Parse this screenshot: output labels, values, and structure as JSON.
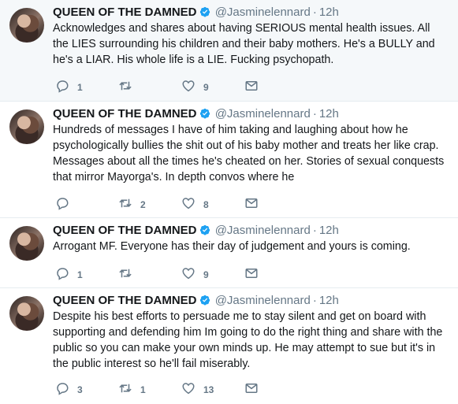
{
  "tweets": [
    {
      "name": "QUEEN OF THE DAMNED",
      "handle": "@Jasminelennard",
      "time": "12h",
      "text": "Acknowledges and shares about having SERIOUS mental health issues. All the LIES surrounding his children and their baby mothers. He's a BULLY and he's a LIAR. His whole life is a LIE. Fucking psychopath.",
      "replies": "1",
      "retweets": "",
      "likes": "9"
    },
    {
      "name": "QUEEN OF THE DAMNED",
      "handle": "@Jasminelennard",
      "time": "12h",
      "text": "Hundreds of messages I have of him taking and laughing about how he psychologically bullies the shit out of his baby mother and treats her like crap. Messages about all the times he's cheated on her. Stories of sexual conquests that mirror Mayorga's. In depth convos where he",
      "replies": "",
      "retweets": "2",
      "likes": "8"
    },
    {
      "name": "QUEEN OF THE DAMNED",
      "handle": "@Jasminelennard",
      "time": "12h",
      "text": "Arrogant MF. Everyone has their day of judgement and yours is coming.",
      "replies": "1",
      "retweets": "",
      "likes": "9"
    },
    {
      "name": "QUEEN OF THE DAMNED",
      "handle": "@Jasminelennard",
      "time": "12h",
      "text": "Despite his best efforts to persuade me to stay silent and get on board with supporting and defending him Im going to do the right thing and share with the public so you can make your own minds up. He may attempt to sue but it's in the public interest so he'll fail miserably.",
      "replies": "3",
      "retweets": "1",
      "likes": "13"
    }
  ],
  "ui": {
    "dot": "·",
    "icons": [
      "verified-badge-icon",
      "reply-icon",
      "retweet-icon",
      "like-heart-icon",
      "direct-message-icon"
    ],
    "colors": {
      "verified": "#1da1f2",
      "muted": "#657786",
      "text": "#14171a",
      "border": "#e6ecf0",
      "highlight_bg": "#f5f8fa"
    }
  }
}
